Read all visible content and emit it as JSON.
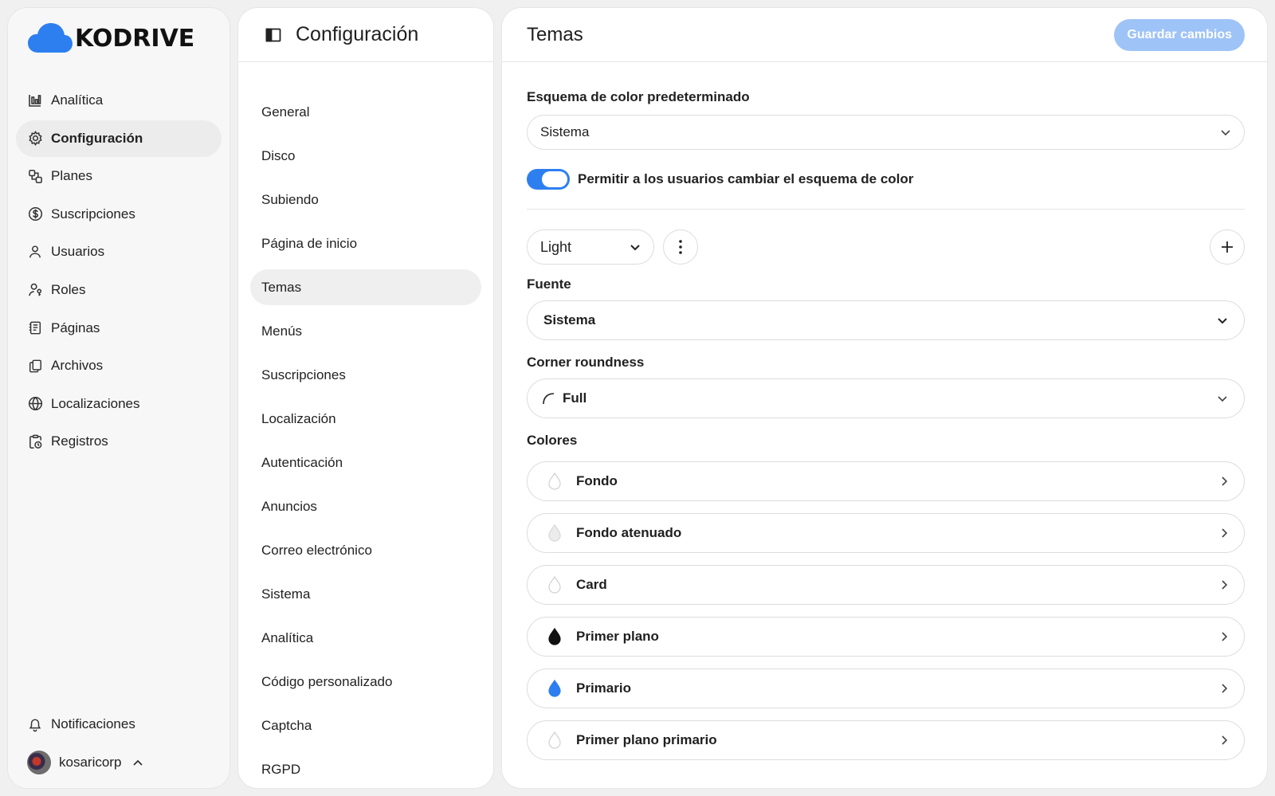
{
  "app": {
    "logo_text": "KODRIVE",
    "accent": "#2d7ff0"
  },
  "sidebar": {
    "items": [
      {
        "label": "Analítica",
        "icon": "chart-bar-icon"
      },
      {
        "label": "Configuración",
        "icon": "gear-icon",
        "active": true
      },
      {
        "label": "Planes",
        "icon": "plans-icon"
      },
      {
        "label": "Suscripciones",
        "icon": "dollar-circle-icon"
      },
      {
        "label": "Usuarios",
        "icon": "user-icon"
      },
      {
        "label": "Roles",
        "icon": "user-key-icon"
      },
      {
        "label": "Páginas",
        "icon": "document-icon"
      },
      {
        "label": "Archivos",
        "icon": "files-icon"
      },
      {
        "label": "Localizaciones",
        "icon": "globe-icon"
      },
      {
        "label": "Registros",
        "icon": "clipboard-clock-icon"
      }
    ],
    "notifications_label": "Notificaciones",
    "username": "kosaricorp"
  },
  "settings_nav": {
    "title": "Configuración",
    "items": [
      {
        "label": "General"
      },
      {
        "label": "Disco"
      },
      {
        "label": "Subiendo"
      },
      {
        "label": "Página de inicio"
      },
      {
        "label": "Temas",
        "active": true
      },
      {
        "label": "Menús"
      },
      {
        "label": "Suscripciones"
      },
      {
        "label": "Localización"
      },
      {
        "label": "Autenticación"
      },
      {
        "label": "Anuncios"
      },
      {
        "label": "Correo electrónico"
      },
      {
        "label": "Sistema"
      },
      {
        "label": "Analítica"
      },
      {
        "label": "Código personalizado"
      },
      {
        "label": "Captcha"
      },
      {
        "label": "RGPD"
      }
    ]
  },
  "main": {
    "title": "Temas",
    "save_label": "Guardar cambios",
    "color_scheme_label": "Esquema de color predeterminado",
    "color_scheme_value": "Sistema",
    "toggle_label": "Permitir a los usuarios cambiar el esquema de color",
    "toggle_on": true,
    "theme_value": "Light",
    "font_label": "Fuente",
    "font_value": "Sistema",
    "corner_label": "Corner roundness",
    "corner_value": "Full",
    "colors_label": "Colores",
    "colors": [
      {
        "label": "Fondo",
        "swatch": "#ffffff"
      },
      {
        "label": "Fondo atenuado",
        "swatch": "#f2f2f2"
      },
      {
        "label": "Card",
        "swatch": "#ffffff"
      },
      {
        "label": "Primer plano",
        "swatch": "#111111"
      },
      {
        "label": "Primario",
        "swatch": "#2d7ff0"
      },
      {
        "label": "Primer plano primario",
        "swatch": "#ffffff"
      }
    ]
  }
}
